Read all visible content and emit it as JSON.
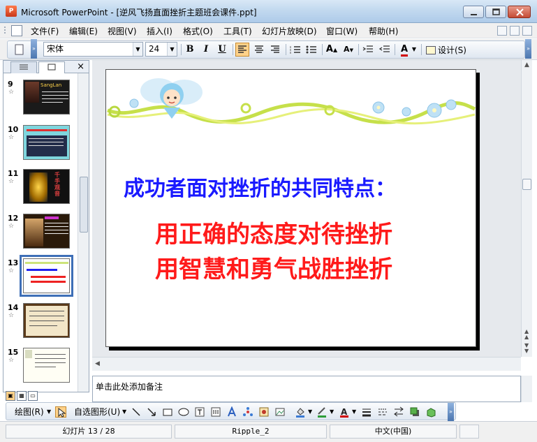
{
  "window": {
    "title": "Microsoft PowerPoint - [逆风飞扬直面挫折主题班会课件.ppt]",
    "app_badge": "P"
  },
  "menu": {
    "items": [
      "文件(F)",
      "编辑(E)",
      "视图(V)",
      "插入(I)",
      "格式(O)",
      "工具(T)",
      "幻灯片放映(D)",
      "窗口(W)",
      "帮助(H)"
    ]
  },
  "format_toolbar": {
    "font_name": "宋体",
    "font_size": "24",
    "bold": "B",
    "italic": "I",
    "underline": "U",
    "design_label": "设计(S)"
  },
  "slides_pane": {
    "tabs": [
      "outline-icon",
      "slides-icon"
    ],
    "close_label": "×",
    "thumbnails": [
      {
        "number": "9",
        "caption": "SangLan"
      },
      {
        "number": "10"
      },
      {
        "number": "11",
        "caption": "千手观音"
      },
      {
        "number": "12"
      },
      {
        "number": "13",
        "selected": true
      },
      {
        "number": "14"
      },
      {
        "number": "15"
      }
    ]
  },
  "slide": {
    "heading": "成功者面对挫折的共同特点：",
    "lines": [
      "用正确的态度对待挫折",
      "用智慧和勇气战胜挫折"
    ],
    "heading_color": "#1a1aff",
    "lines_color": "#ff1a1a"
  },
  "notes": {
    "placeholder": "单击此处添加备注"
  },
  "drawing_toolbar": {
    "draw_label": "绘图(R)",
    "autoshapes_label": "自选图形(U)"
  },
  "status": {
    "slide_counter": "幻灯片 13 / 28",
    "design_template": "Ripple_2",
    "language": "中文(中国)"
  }
}
